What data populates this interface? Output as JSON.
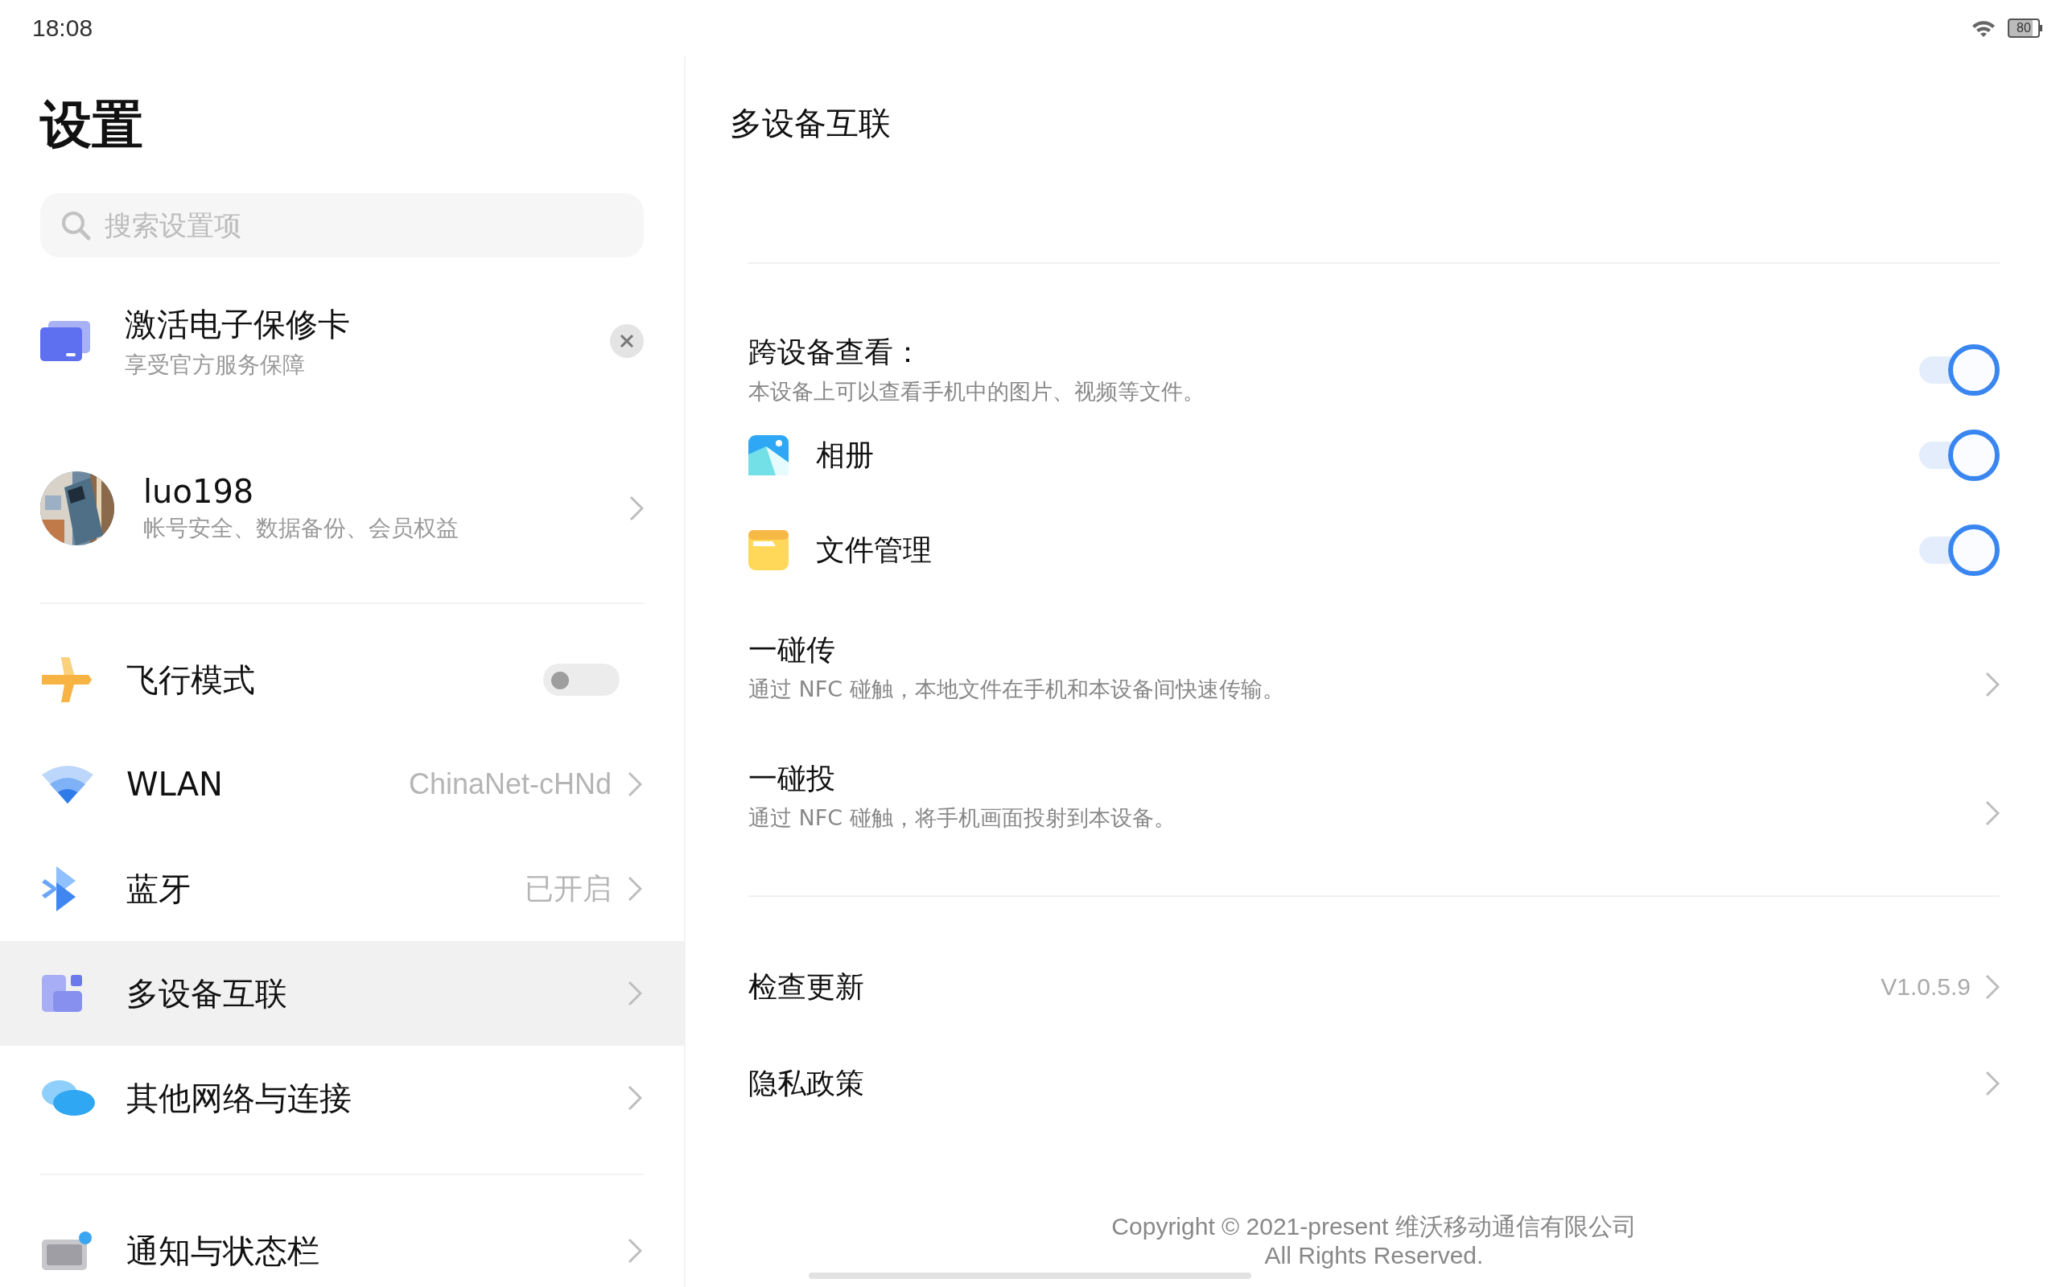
{
  "status_bar": {
    "time": "18:08",
    "battery": "80"
  },
  "sidebar": {
    "title": "设置",
    "search": {
      "placeholder": "搜索设置项"
    },
    "promo": {
      "title": "激活电子保修卡",
      "subtitle": "享受官方服务保障"
    },
    "account": {
      "name": "luo198",
      "subtitle": "帐号安全、数据备份、会员权益"
    },
    "sections": [
      {
        "items": [
          {
            "kind": "toggle",
            "label": "飞行模式",
            "on": false,
            "selected": false
          },
          {
            "kind": "link",
            "label": "WLAN",
            "value": "ChinaNet-cHNd",
            "selected": false
          },
          {
            "kind": "link",
            "label": "蓝牙",
            "value": "已开启",
            "selected": false
          },
          {
            "kind": "link",
            "label": "多设备互联",
            "selected": true
          },
          {
            "kind": "link",
            "label": "其他网络与连接",
            "selected": false
          }
        ]
      },
      {
        "items": [
          {
            "kind": "link",
            "label": "通知与状态栏",
            "selected": false
          }
        ]
      }
    ]
  },
  "content": {
    "title": "多设备互联",
    "sections": [
      {
        "rows": [
          {
            "kind": "toggle_desc",
            "label": "跨设备查看：",
            "description": "本设备上可以查看手机中的图片、视频等文件。",
            "on": true
          },
          {
            "kind": "app_toggle",
            "label": "相册",
            "on": true
          },
          {
            "kind": "app_toggle",
            "label": "文件管理",
            "on": true
          },
          {
            "kind": "link_desc",
            "label": "一碰传",
            "description": "通过 NFC 碰触，本地文件在手机和本设备间快速传输。"
          },
          {
            "kind": "link_desc",
            "label": "一碰投",
            "description": "通过 NFC 碰触，将手机画面投射到本设备。"
          }
        ]
      },
      {
        "rows": [
          {
            "kind": "link",
            "label": "检查更新",
            "value": "V1.0.5.9"
          },
          {
            "kind": "link",
            "label": "隐私政策"
          }
        ]
      }
    ],
    "footer": [
      "Copyright © 2021-present 维沃移动通信有限公司",
      "All Rights Reserved."
    ]
  }
}
